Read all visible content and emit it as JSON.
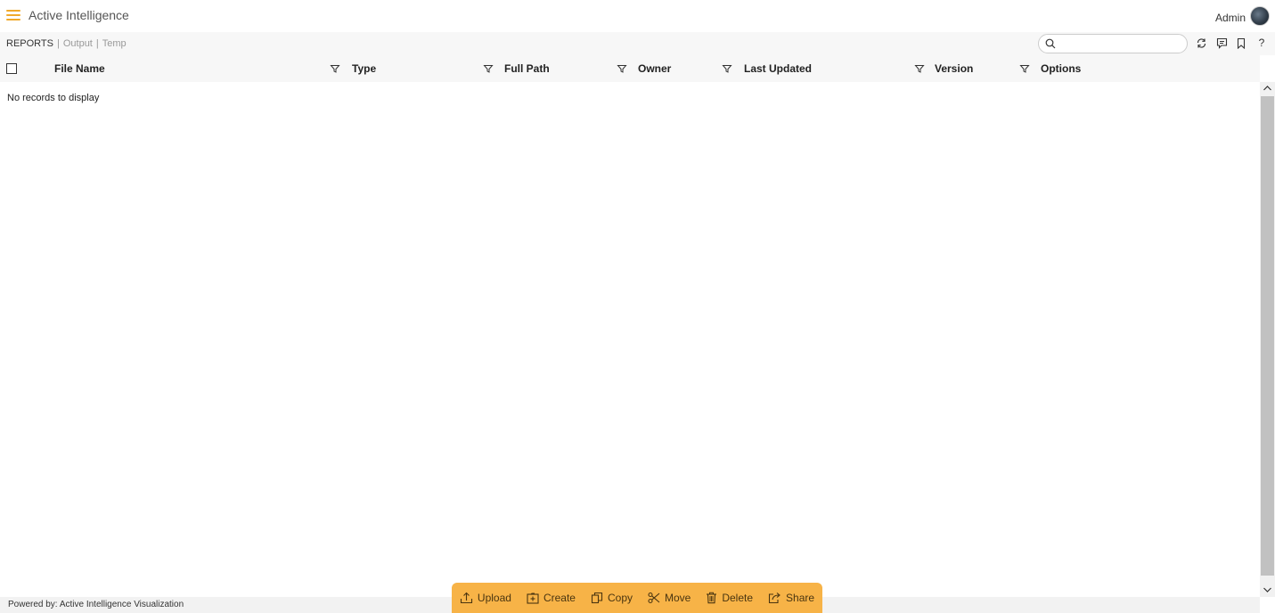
{
  "app": {
    "title": "Active Intelligence"
  },
  "user": {
    "name": "Admin"
  },
  "breadcrumbs": [
    {
      "label": "REPORTS"
    },
    {
      "label": "Output"
    },
    {
      "label": "Temp"
    }
  ],
  "separators": [
    "|",
    "|"
  ],
  "search": {
    "placeholder": "",
    "value": ""
  },
  "toolbar": {
    "icons": [
      "refresh-icon",
      "comment-icon",
      "bookmark-icon",
      "help-icon"
    ],
    "help_glyph": "?"
  },
  "grid": {
    "columns": [
      {
        "label": "File Name"
      },
      {
        "label": "Type"
      },
      {
        "label": "Full Path"
      },
      {
        "label": "Owner"
      },
      {
        "label": "Last Updated"
      },
      {
        "label": "Version"
      },
      {
        "label": "Options"
      }
    ],
    "empty_message": "No records to display"
  },
  "footer": {
    "powered_by": "Powered by: Active Intelligence Visualization"
  },
  "actions": [
    {
      "label": "Upload",
      "icon": "upload-icon"
    },
    {
      "label": "Create",
      "icon": "create-icon"
    },
    {
      "label": "Copy",
      "icon": "copy-icon"
    },
    {
      "label": "Move",
      "icon": "scissors-icon"
    },
    {
      "label": "Delete",
      "icon": "trash-icon"
    },
    {
      "label": "Share",
      "icon": "share-icon"
    }
  ],
  "colors": {
    "accent": "#f0a92b",
    "action_bar": "#f7b347",
    "header_bg": "#f7f7f7"
  }
}
